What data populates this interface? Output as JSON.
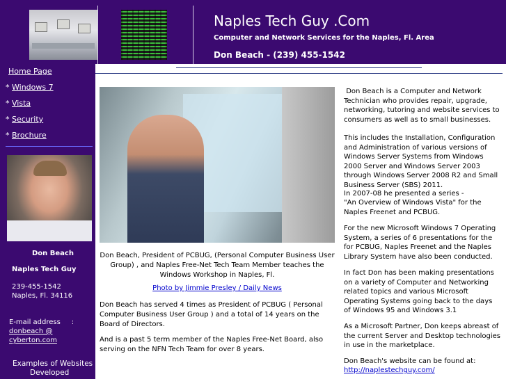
{
  "header": {
    "title": "Naples Tech Guy .Com",
    "subtitle": "Computer and Network Services for the Naples, Fl. Area",
    "contact": "Don Beach - (239) 455-1542"
  },
  "nav": {
    "items": [
      {
        "label": "Home Page"
      },
      {
        "label": "Windows 7"
      },
      {
        "label": "Vista"
      },
      {
        "label": "Security"
      },
      {
        "label": "Brochure"
      }
    ],
    "bullet": "*"
  },
  "sidebar": {
    "name": "Don Beach",
    "business": "Naples Tech Guy",
    "phone": "239-455-1542",
    "city": "Naples, Fl. 34116",
    "email_label": "E-mail address     :",
    "email_line1": "donbeach @",
    "email_line2": "cyberton.com",
    "examples_line1": "Examples of Websites",
    "examples_line2": "Developed"
  },
  "main": {
    "caption": "Don Beach, President of PCBUG, (Personal Computer Business User Group) , and Naples Free-Net Tech Team Member teaches the Windows Workshop in Naples, Fl.",
    "photo_credit": "Photo by Jimmie Presley / Daily News",
    "para1": "Don Beach has served 4 times as President of PCBUG ( Personal Computer Business User Group ) and a total of 14 years on the Board of Directors.",
    "para2": "And is a past 5 term member of the Naples Free-Net Board, also serving on the NFN Tech Team for over 8 years."
  },
  "right": {
    "p1": " Don Beach is a Computer and Network Technician who provides repair, upgrade, networking, tutoring and website services to consumers as well as to small businesses.",
    "p2": "This includes the Installation, Configuration and Administration of various versions of Windows Server Systems from Windows 2000 Server and Windows Server 2003 through Windows Server 2008 R2 and Small Business Server (SBS) 2011.",
    "p3a": "In 2007-08 he presented a series -",
    "p3b": "\"An Overview of Windows Vista\" for the Naples Freenet and PCBUG.",
    "p4": "For the new Microsoft Windows 7 Operating System, a series of 6 presentations for the for PCBUG, Naples Freenet and the Naples Library System have also been conducted.",
    "p5": "In fact Don has been making presentations on a variety of Computer and Networking related topics and various Microsoft Operating Systems going back to the days of Windows 95 and Windows 3.1",
    "p6": "As a Microsoft Partner, Don keeps abreast of the current Server and Desktop technologies in use in the marketplace.",
    "p7": "Don Beach's website can be found at:",
    "link": "http://naplestechguy.com/"
  }
}
